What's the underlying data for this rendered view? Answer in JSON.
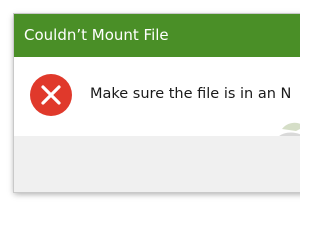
{
  "dialog": {
    "title": "Couldn’t Mount File",
    "message": "Make sure the file is in an N",
    "icon": "error-x-icon",
    "colors": {
      "title_bar": "#4a8f27",
      "title_text": "#ffffff",
      "error_icon": "#e0392b",
      "footer": "#f0f0f0"
    }
  }
}
